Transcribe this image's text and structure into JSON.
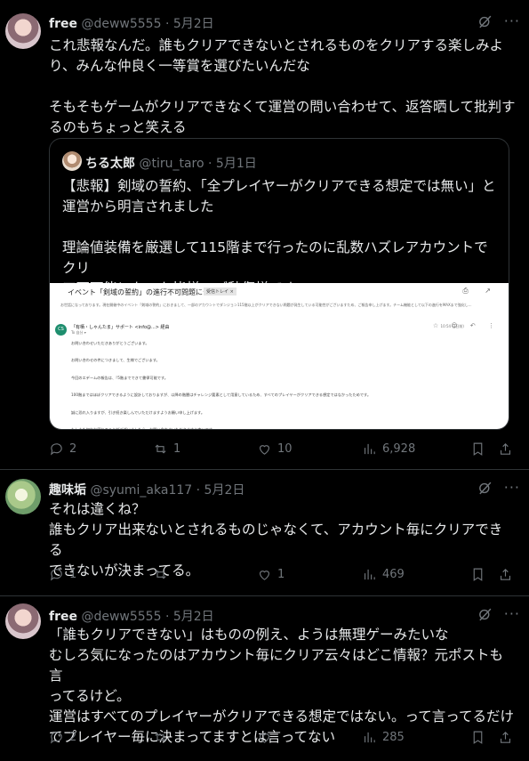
{
  "posts": [
    {
      "name": "free",
      "handle": "@deww5555",
      "sep": "·",
      "date": "5月2日",
      "text": "これ悲報なんだ。誰もクリアできないとされるものをクリアする楽しみよ\nり、みんな仲良く一等賞を選びたいんだな\n\nそもそもゲームがクリアできなくて運営の問い合わせて、返答晒して批判す\nるのもちょっと笑える",
      "replies": "2",
      "reposts": "1",
      "likes": "10",
      "views": "6,928"
    },
    {
      "name": "趣味垢",
      "handle": "@syumi_aka117",
      "sep": "·",
      "date": "5月2日",
      "text": "それは違くね？\n誰もクリア出来ないとされるものじゃなくて、アカウント毎にクリアできる\nできないが決まってる。",
      "replies": "1",
      "reposts": "",
      "likes": "1",
      "views": "469"
    },
    {
      "name": "free",
      "handle": "@deww5555",
      "sep": "·",
      "date": "5月2日",
      "text": "「誰もクリアできない」はものの例え、ようは無理ゲーみたいな\nむしろ気になったのはアカウント毎にクリア云々はどこ情報？元ポストも言\nってるけど。\n運営はすべてのプレイヤーがクリアできる想定ではない。って言ってるだけ\nでプレイヤー毎に決まってますとは言ってない",
      "replies": "2",
      "reposts": "",
      "likes": "",
      "views": "285"
    }
  ],
  "quote": {
    "name": "ちる太郎",
    "handle": "@tiru_taro",
    "sep": "·",
    "date": "5月1日",
    "text": "【悲報】剣域の誓約、「全プレイヤーがクリアできる想定では無い」と\n運営から明言されました\n\n理論値装備を厳選して115階まで行ったのに乱数ハズレアカウントでクリ\nア不可能になった皆様、ご愁傷様です...",
    "image": {
      "subject": "イベント「剣域の誓約」の進行不可問題について",
      "tag": "受信トレイ ×",
      "info": "お世話になっております。現在開催中のイベント「剣域の誓約」におきまして、一部のアカウントでダンジョン115階以上がクリアできない問題が発生している可能性がございますため、ご報告申し上げます。チーム機能として以下の進行をMAXまで強化し...",
      "avatar": "CS",
      "from": "「有栖・しゃんたま」サポート <info@...> 経由",
      "to": "To 自分 ▾",
      "date": "10:54 (1日前)",
      "body": "お問い合わせいただきありがとうございます。\n\nお問い合わせの件につきまして、生様でございます。\n\n今回のエデームの報告は、『5階までできて書律可能です。\n\n100階まではほぼクリアできるように設計しておりますが、以降の階層はチャレンジ要素として用意しているため、すべてのプレイヤーがクリアできる想定ではなかったためです。\n\n誠に恐れ入りますが、引き続き楽しんでいただけますようお願い申し上げます。\n\nもしまた何かお困りのことがございましたら、お問い合わせいただきますと幸いです。\n\n今後ともどうぞよろしくお願いいたします。\n\n「有栖・しゃんたま」運営事務局"
    }
  },
  "icons": {
    "grok": "grok-icon",
    "more": "more-icon",
    "reply": "reply-icon",
    "repost": "repost-icon",
    "like": "like-icon",
    "views": "views-icon",
    "bookmark": "bookmark-icon",
    "share": "share-icon"
  }
}
